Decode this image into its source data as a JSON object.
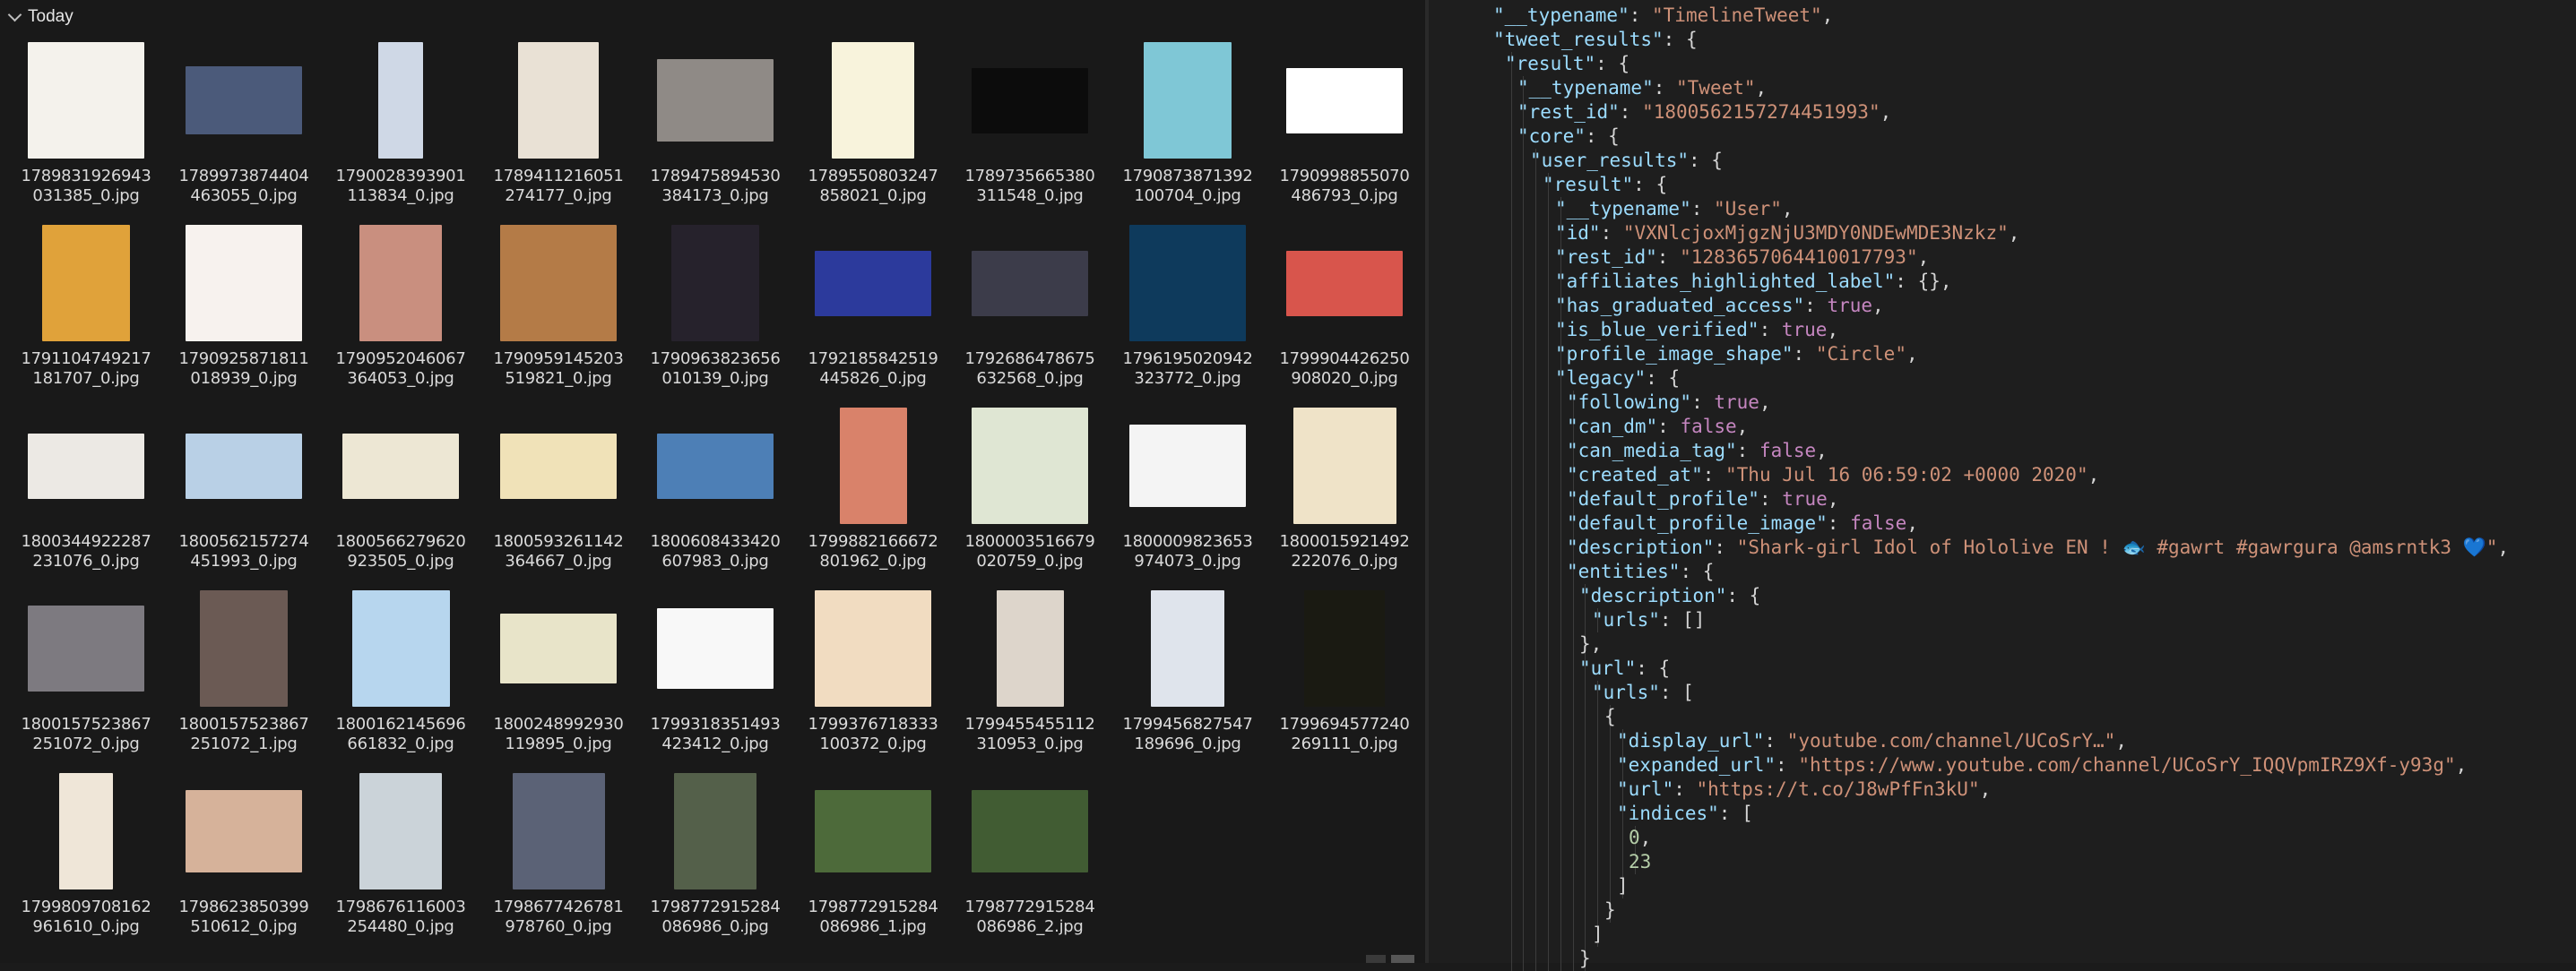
{
  "explorer": {
    "group_label": "Today",
    "files": [
      {
        "name_line1": "1789831926943",
        "name_line2": "031385_0.jpg",
        "thumb_color": "#f4f2ec",
        "w": 130,
        "h": 130
      },
      {
        "name_line1": "1789973874404",
        "name_line2": "463055_0.jpg",
        "thumb_color": "#4b5a7a",
        "w": 130,
        "h": 76
      },
      {
        "name_line1": "1790028393901",
        "name_line2": "113834_0.jpg",
        "thumb_color": "#cfd8e6",
        "w": 50,
        "h": 130
      },
      {
        "name_line1": "1789411216051",
        "name_line2": "274177_0.jpg",
        "thumb_color": "#e9e1d5",
        "w": 90,
        "h": 130
      },
      {
        "name_line1": "1789475894530",
        "name_line2": "384173_0.jpg",
        "thumb_color": "#8f8a86",
        "w": 130,
        "h": 92
      },
      {
        "name_line1": "1789550803247",
        "name_line2": "858021_0.jpg",
        "thumb_color": "#f8f3dc",
        "w": 92,
        "h": 130
      },
      {
        "name_line1": "1789735665380",
        "name_line2": "311548_0.jpg",
        "thumb_color": "#0c0c0c",
        "w": 130,
        "h": 73
      },
      {
        "name_line1": "1790873871392",
        "name_line2": "100704_0.jpg",
        "thumb_color": "#7fc7d6",
        "w": 98,
        "h": 130
      },
      {
        "name_line1": "1790998855070",
        "name_line2": "486793_0.jpg",
        "thumb_color": "#ffffff",
        "w": 130,
        "h": 73
      },
      {
        "name_line1": "1791104749217",
        "name_line2": "181707_0.jpg",
        "thumb_color": "#e0a23a",
        "w": 98,
        "h": 130
      },
      {
        "name_line1": "1790925871811",
        "name_line2": "018939_0.jpg",
        "thumb_color": "#f7f2ee",
        "w": 130,
        "h": 130
      },
      {
        "name_line1": "1790952046067",
        "name_line2": "364053_0.jpg",
        "thumb_color": "#c98f7f",
        "w": 92,
        "h": 130
      },
      {
        "name_line1": "1790959145203",
        "name_line2": "519821_0.jpg",
        "thumb_color": "#b47b47",
        "w": 130,
        "h": 130
      },
      {
        "name_line1": "1790963823656",
        "name_line2": "010139_0.jpg",
        "thumb_color": "#26222c",
        "w": 98,
        "h": 130
      },
      {
        "name_line1": "1792185842519",
        "name_line2": "445826_0.jpg",
        "thumb_color": "#2c3a9c",
        "w": 130,
        "h": 73
      },
      {
        "name_line1": "1792686478675",
        "name_line2": "632568_0.jpg",
        "thumb_color": "#3c3c4a",
        "w": 130,
        "h": 73
      },
      {
        "name_line1": "1796195020942",
        "name_line2": "323772_0.jpg",
        "thumb_color": "#0e3a5c",
        "w": 130,
        "h": 130
      },
      {
        "name_line1": "1799904426250",
        "name_line2": "908020_0.jpg",
        "thumb_color": "#d8554c",
        "w": 130,
        "h": 73
      },
      {
        "name_line1": "1800344922287",
        "name_line2": "231076_0.jpg",
        "thumb_color": "#ece9e4",
        "w": 130,
        "h": 73
      },
      {
        "name_line1": "1800562157274",
        "name_line2": "451993_0.jpg",
        "thumb_color": "#b9d0e6",
        "w": 130,
        "h": 73
      },
      {
        "name_line1": "1800566279620",
        "name_line2": "923505_0.jpg",
        "thumb_color": "#ede7d4",
        "w": 130,
        "h": 73
      },
      {
        "name_line1": "1800593261142",
        "name_line2": "364667_0.jpg",
        "thumb_color": "#f0e2b8",
        "w": 130,
        "h": 73
      },
      {
        "name_line1": "1800608433420",
        "name_line2": "607983_0.jpg",
        "thumb_color": "#4d7fb6",
        "w": 130,
        "h": 73
      },
      {
        "name_line1": "1799882166672",
        "name_line2": "801962_0.jpg",
        "thumb_color": "#d9826a",
        "w": 75,
        "h": 130
      },
      {
        "name_line1": "1800003516679",
        "name_line2": "020759_0.jpg",
        "thumb_color": "#dfe6d3",
        "w": 130,
        "h": 130
      },
      {
        "name_line1": "1800009823653",
        "name_line2": "974073_0.jpg",
        "thumb_color": "#f4f4f4",
        "w": 130,
        "h": 92
      },
      {
        "name_line1": "1800015921492",
        "name_line2": "222076_0.jpg",
        "thumb_color": "#efe3c8",
        "w": 115,
        "h": 130
      },
      {
        "name_line1": "1800157523867",
        "name_line2": "251072_0.jpg",
        "thumb_color": "#7d7a80",
        "w": 130,
        "h": 96
      },
      {
        "name_line1": "1800157523867",
        "name_line2": "251072_1.jpg",
        "thumb_color": "#6b5a54",
        "w": 98,
        "h": 130
      },
      {
        "name_line1": "1800162145696",
        "name_line2": "661832_0.jpg",
        "thumb_color": "#b7d6ee",
        "w": 109,
        "h": 130
      },
      {
        "name_line1": "1800248992930",
        "name_line2": "119895_0.jpg",
        "thumb_color": "#e8e4c9",
        "w": 130,
        "h": 78
      },
      {
        "name_line1": "1799318351493",
        "name_line2": "423412_0.jpg",
        "thumb_color": "#f8f8f8",
        "w": 130,
        "h": 90
      },
      {
        "name_line1": "1799376718333",
        "name_line2": "100372_0.jpg",
        "thumb_color": "#f1dcc1",
        "w": 130,
        "h": 130
      },
      {
        "name_line1": "1799455455112",
        "name_line2": "310953_0.jpg",
        "thumb_color": "#ddd5cb",
        "w": 75,
        "h": 130
      },
      {
        "name_line1": "1799456827547",
        "name_line2": "189696_0.jpg",
        "thumb_color": "#dfe4ec",
        "w": 82,
        "h": 130
      },
      {
        "name_line1": "1799694577240",
        "name_line2": "269111_0.jpg",
        "thumb_color": "#1a1a12",
        "w": 90,
        "h": 130
      },
      {
        "name_line1": "1799809708162",
        "name_line2": "961610_0.jpg",
        "thumb_color": "#efe6d8",
        "w": 60,
        "h": 130
      },
      {
        "name_line1": "1798623850399",
        "name_line2": "510612_0.jpg",
        "thumb_color": "#d6b29a",
        "w": 130,
        "h": 92
      },
      {
        "name_line1": "1798676116003",
        "name_line2": "254480_0.jpg",
        "thumb_color": "#cbd3d9",
        "w": 92,
        "h": 130
      },
      {
        "name_line1": "1798677426781",
        "name_line2": "978760_0.jpg",
        "thumb_color": "#5b6276",
        "w": 103,
        "h": 130
      },
      {
        "name_line1": "1798772915284",
        "name_line2": "086986_0.jpg",
        "thumb_color": "#54604a",
        "w": 92,
        "h": 130
      },
      {
        "name_line1": "1798772915284",
        "name_line2": "086986_1.jpg",
        "thumb_color": "#4d6a3a",
        "w": 130,
        "h": 92
      },
      {
        "name_line1": "1798772915284",
        "name_line2": "086986_2.jpg",
        "thumb_color": "#415c33",
        "w": 130,
        "h": 92
      }
    ]
  },
  "editor": {
    "colors": {
      "key": "#9cdcfe",
      "string": "#ce9178",
      "keyword": "#c586c0",
      "number": "#b5cea8",
      "punct": "#d4d4d4",
      "background": "#1e1e1e"
    },
    "lines": [
      {
        "indent": 2,
        "tokens": [
          {
            "t": "k",
            "v": "\"__typename\""
          },
          {
            "t": "p",
            "v": ": "
          },
          {
            "t": "s",
            "v": "\"TimelineTweet\""
          },
          {
            "t": "p",
            "v": ","
          }
        ]
      },
      {
        "indent": 2,
        "tokens": [
          {
            "t": "k",
            "v": "\"tweet_results\""
          },
          {
            "t": "p",
            "v": ": {"
          }
        ]
      },
      {
        "indent": 3,
        "tokens": [
          {
            "t": "k",
            "v": "\"result\""
          },
          {
            "t": "p",
            "v": ": {"
          }
        ]
      },
      {
        "indent": 4,
        "tokens": [
          {
            "t": "k",
            "v": "\"__typename\""
          },
          {
            "t": "p",
            "v": ": "
          },
          {
            "t": "s",
            "v": "\"Tweet\""
          },
          {
            "t": "p",
            "v": ","
          }
        ]
      },
      {
        "indent": 4,
        "tokens": [
          {
            "t": "k",
            "v": "\"rest_id\""
          },
          {
            "t": "p",
            "v": ": "
          },
          {
            "t": "s",
            "v": "\"1800562157274451993\""
          },
          {
            "t": "p",
            "v": ","
          }
        ]
      },
      {
        "indent": 4,
        "tokens": [
          {
            "t": "k",
            "v": "\"core\""
          },
          {
            "t": "p",
            "v": ": {"
          }
        ]
      },
      {
        "indent": 5,
        "tokens": [
          {
            "t": "k",
            "v": "\"user_results\""
          },
          {
            "t": "p",
            "v": ": {"
          }
        ]
      },
      {
        "indent": 6,
        "tokens": [
          {
            "t": "k",
            "v": "\"result\""
          },
          {
            "t": "p",
            "v": ": {"
          }
        ]
      },
      {
        "indent": 7,
        "tokens": [
          {
            "t": "k",
            "v": "\"__typename\""
          },
          {
            "t": "p",
            "v": ": "
          },
          {
            "t": "s",
            "v": "\"User\""
          },
          {
            "t": "p",
            "v": ","
          }
        ]
      },
      {
        "indent": 7,
        "tokens": [
          {
            "t": "k",
            "v": "\"id\""
          },
          {
            "t": "p",
            "v": ": "
          },
          {
            "t": "s",
            "v": "\"VXNlcjoxMjgzNjU3MDY0NDEwMDE3Nzkz\""
          },
          {
            "t": "p",
            "v": ","
          }
        ]
      },
      {
        "indent": 7,
        "tokens": [
          {
            "t": "k",
            "v": "\"rest_id\""
          },
          {
            "t": "p",
            "v": ": "
          },
          {
            "t": "s",
            "v": "\"1283657064410017793\""
          },
          {
            "t": "p",
            "v": ","
          }
        ]
      },
      {
        "indent": 7,
        "tokens": [
          {
            "t": "k",
            "v": "\"affiliates_highlighted_label\""
          },
          {
            "t": "p",
            "v": ": {},"
          }
        ]
      },
      {
        "indent": 7,
        "tokens": [
          {
            "t": "k",
            "v": "\"has_graduated_access\""
          },
          {
            "t": "p",
            "v": ": "
          },
          {
            "t": "kw",
            "v": "true"
          },
          {
            "t": "p",
            "v": ","
          }
        ]
      },
      {
        "indent": 7,
        "tokens": [
          {
            "t": "k",
            "v": "\"is_blue_verified\""
          },
          {
            "t": "p",
            "v": ": "
          },
          {
            "t": "kw",
            "v": "true"
          },
          {
            "t": "p",
            "v": ","
          }
        ]
      },
      {
        "indent": 7,
        "tokens": [
          {
            "t": "k",
            "v": "\"profile_image_shape\""
          },
          {
            "t": "p",
            "v": ": "
          },
          {
            "t": "s",
            "v": "\"Circle\""
          },
          {
            "t": "p",
            "v": ","
          }
        ]
      },
      {
        "indent": 7,
        "tokens": [
          {
            "t": "k",
            "v": "\"legacy\""
          },
          {
            "t": "p",
            "v": ": {"
          }
        ]
      },
      {
        "indent": 8,
        "tokens": [
          {
            "t": "k",
            "v": "\"following\""
          },
          {
            "t": "p",
            "v": ": "
          },
          {
            "t": "kw",
            "v": "true"
          },
          {
            "t": "p",
            "v": ","
          }
        ]
      },
      {
        "indent": 8,
        "tokens": [
          {
            "t": "k",
            "v": "\"can_dm\""
          },
          {
            "t": "p",
            "v": ": "
          },
          {
            "t": "kw",
            "v": "false"
          },
          {
            "t": "p",
            "v": ","
          }
        ]
      },
      {
        "indent": 8,
        "tokens": [
          {
            "t": "k",
            "v": "\"can_media_tag\""
          },
          {
            "t": "p",
            "v": ": "
          },
          {
            "t": "kw",
            "v": "false"
          },
          {
            "t": "p",
            "v": ","
          }
        ]
      },
      {
        "indent": 8,
        "tokens": [
          {
            "t": "k",
            "v": "\"created_at\""
          },
          {
            "t": "p",
            "v": ": "
          },
          {
            "t": "s",
            "v": "\"Thu Jul 16 06:59:02 +0000 2020\""
          },
          {
            "t": "p",
            "v": ","
          }
        ]
      },
      {
        "indent": 8,
        "tokens": [
          {
            "t": "k",
            "v": "\"default_profile\""
          },
          {
            "t": "p",
            "v": ": "
          },
          {
            "t": "kw",
            "v": "true"
          },
          {
            "t": "p",
            "v": ","
          }
        ]
      },
      {
        "indent": 8,
        "tokens": [
          {
            "t": "k",
            "v": "\"default_profile_image\""
          },
          {
            "t": "p",
            "v": ": "
          },
          {
            "t": "kw",
            "v": "false"
          },
          {
            "t": "p",
            "v": ","
          }
        ]
      },
      {
        "indent": 8,
        "tokens": [
          {
            "t": "k",
            "v": "\"description\""
          },
          {
            "t": "p",
            "v": ": "
          },
          {
            "t": "s",
            "v": "\"Shark-girl Idol of Hololive EN ! 🐟 #gawrt #gawrgura @amsrntk3 💙\""
          },
          {
            "t": "p",
            "v": ","
          }
        ]
      },
      {
        "indent": 8,
        "tokens": [
          {
            "t": "k",
            "v": "\"entities\""
          },
          {
            "t": "p",
            "v": ": {"
          }
        ]
      },
      {
        "indent": 9,
        "tokens": [
          {
            "t": "k",
            "v": "\"description\""
          },
          {
            "t": "p",
            "v": ": {"
          }
        ]
      },
      {
        "indent": 10,
        "tokens": [
          {
            "t": "k",
            "v": "\"urls\""
          },
          {
            "t": "p",
            "v": ": []"
          }
        ]
      },
      {
        "indent": 9,
        "tokens": [
          {
            "t": "p",
            "v": "},"
          }
        ]
      },
      {
        "indent": 9,
        "tokens": [
          {
            "t": "k",
            "v": "\"url\""
          },
          {
            "t": "p",
            "v": ": {"
          }
        ]
      },
      {
        "indent": 10,
        "tokens": [
          {
            "t": "k",
            "v": "\"urls\""
          },
          {
            "t": "p",
            "v": ": ["
          }
        ]
      },
      {
        "indent": 11,
        "tokens": [
          {
            "t": "p",
            "v": "{"
          }
        ]
      },
      {
        "indent": 12,
        "tokens": [
          {
            "t": "k",
            "v": "\"display_url\""
          },
          {
            "t": "p",
            "v": ": "
          },
          {
            "t": "s",
            "v": "\"youtube.com/channel/UCoSrY…\""
          },
          {
            "t": "p",
            "v": ","
          }
        ]
      },
      {
        "indent": 12,
        "tokens": [
          {
            "t": "k",
            "v": "\"expanded_url\""
          },
          {
            "t": "p",
            "v": ": "
          },
          {
            "t": "s",
            "v": "\"https://www.youtube.com/channel/UCoSrY_IQQVpmIRZ9Xf-y93g\""
          },
          {
            "t": "p",
            "v": ","
          }
        ]
      },
      {
        "indent": 12,
        "tokens": [
          {
            "t": "k",
            "v": "\"url\""
          },
          {
            "t": "p",
            "v": ": "
          },
          {
            "t": "s",
            "v": "\"https://t.co/J8wPfFn3kU\""
          },
          {
            "t": "p",
            "v": ","
          }
        ]
      },
      {
        "indent": 12,
        "tokens": [
          {
            "t": "k",
            "v": "\"indices\""
          },
          {
            "t": "p",
            "v": ": ["
          }
        ]
      },
      {
        "indent": 13,
        "tokens": [
          {
            "t": "n",
            "v": "0"
          },
          {
            "t": "p",
            "v": ","
          }
        ]
      },
      {
        "indent": 13,
        "tokens": [
          {
            "t": "n",
            "v": "23"
          }
        ]
      },
      {
        "indent": 12,
        "tokens": [
          {
            "t": "p",
            "v": "]"
          }
        ]
      },
      {
        "indent": 11,
        "tokens": [
          {
            "t": "p",
            "v": "}"
          }
        ]
      },
      {
        "indent": 10,
        "tokens": [
          {
            "t": "p",
            "v": "]"
          }
        ]
      },
      {
        "indent": 9,
        "tokens": [
          {
            "t": "p",
            "v": "}"
          }
        ]
      }
    ]
  }
}
